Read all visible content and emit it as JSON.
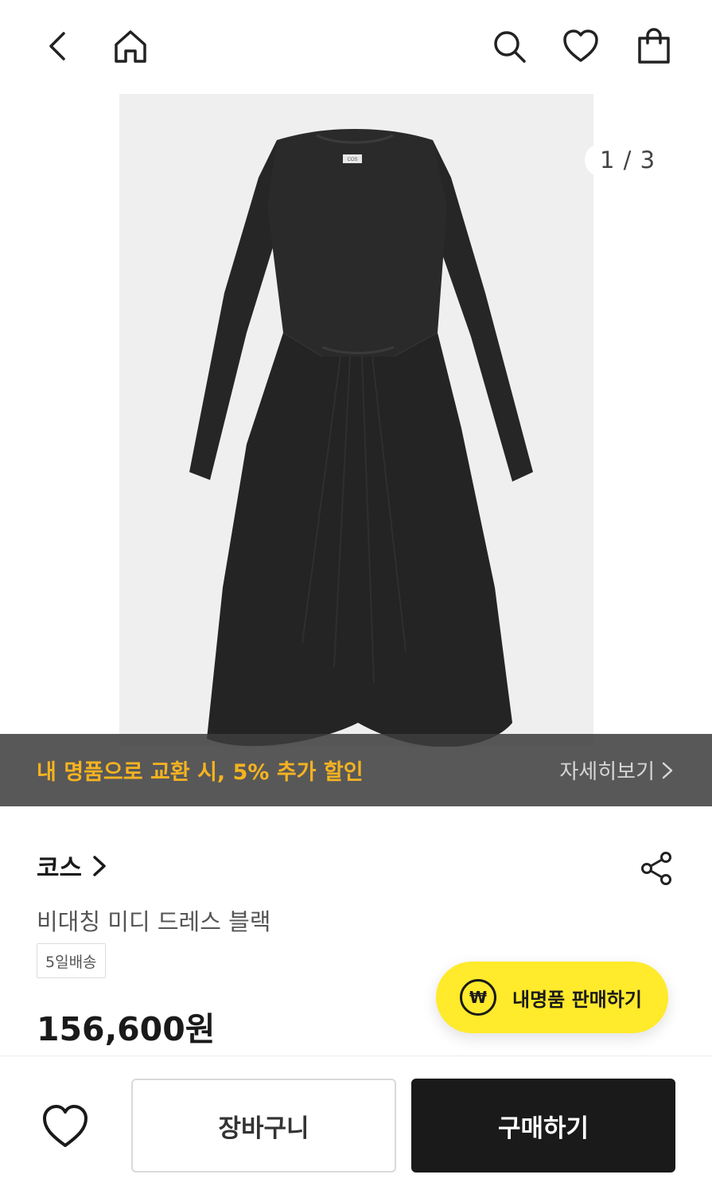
{
  "header": {
    "back_icon": "chevron-left-icon",
    "home_icon": "home-icon",
    "search_icon": "search-icon",
    "wishlist_icon": "heart-icon",
    "bag_icon": "shopping-bag-icon"
  },
  "gallery": {
    "image_counter": "1 / 3",
    "label_text": "COS"
  },
  "promo": {
    "text": "내 명품으로 교환 시, 5% 추가 할인",
    "link_label": "자세히보기",
    "text_color": "#f5b321"
  },
  "product": {
    "brand": "코스",
    "name": "비대칭 미디 드레스 블랙",
    "shipping_tag": "5일배송",
    "price": "156,600원"
  },
  "sell_button": {
    "icon_text": "₩",
    "label": "내명품 판매하기",
    "color": "#ffea2b"
  },
  "bottom_bar": {
    "cart_label": "장바구니",
    "buy_label": "구매하기"
  }
}
